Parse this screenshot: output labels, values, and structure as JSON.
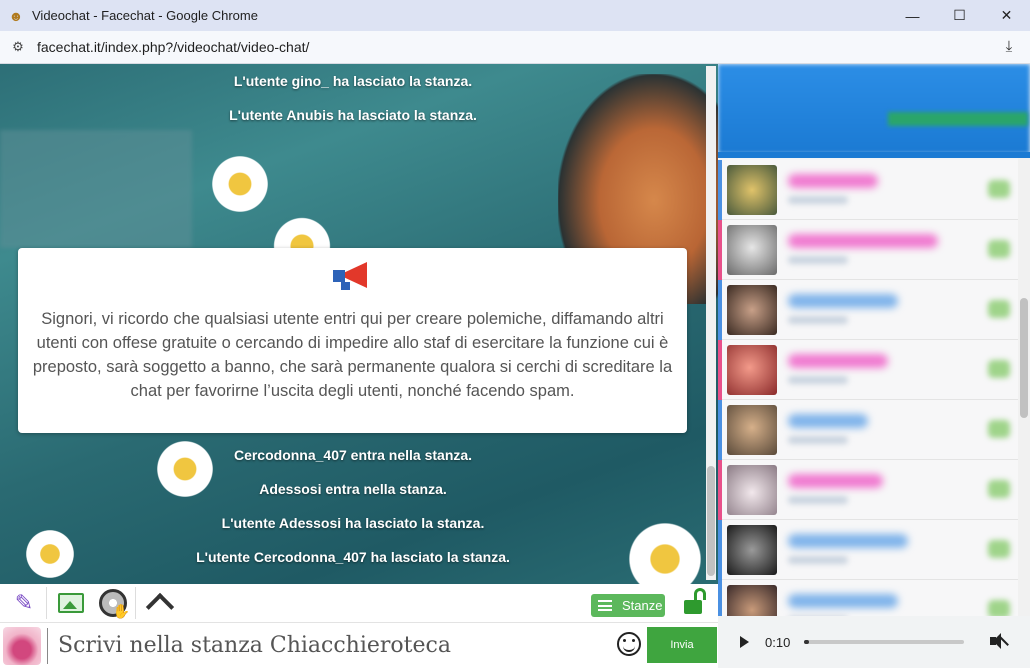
{
  "window": {
    "title": "Videochat - Facechat - Google Chrome",
    "url": "facechat.it/index.php?/videochat/video-chat/",
    "minimize": "—",
    "maximize": "☐",
    "close": "✕"
  },
  "chat": {
    "messages_top": [
      "L'utente gino_ ha lasciato la stanza.",
      "L'utente Anubis ha lasciato la stanza."
    ],
    "notice": "Signori, vi ricordo che qualsiasi utente entri qui per creare polemiche, diffamando altri utenti con offese gratuite o cercando di impedire allo staf di esercitare la funzione cui è preposto, sarà soggetto a banno, che sarà permanente qualora si cerchi di screditare la chat per favorirne l’uscita degli utenti, nonché facendo spam.",
    "messages_bottom": [
      "Cercodonna_407 entra nella stanza.",
      "Adessosi entra nella stanza.",
      "L'utente Adessosi ha lasciato la stanza.",
      "L'utente Cercodonna_407 ha lasciato la stanza."
    ]
  },
  "toolbar": {
    "stanze_label": "Stanze"
  },
  "input": {
    "placeholder": "Scrivi nella stanza Chiacchieroteca",
    "send_label": "Invia"
  },
  "player": {
    "time": "0:10",
    "progress": 0.03
  },
  "colors": {
    "accent_green": "#5cb85c",
    "send_green": "#3fa53f",
    "panel_blue": "#1b7ad3"
  }
}
